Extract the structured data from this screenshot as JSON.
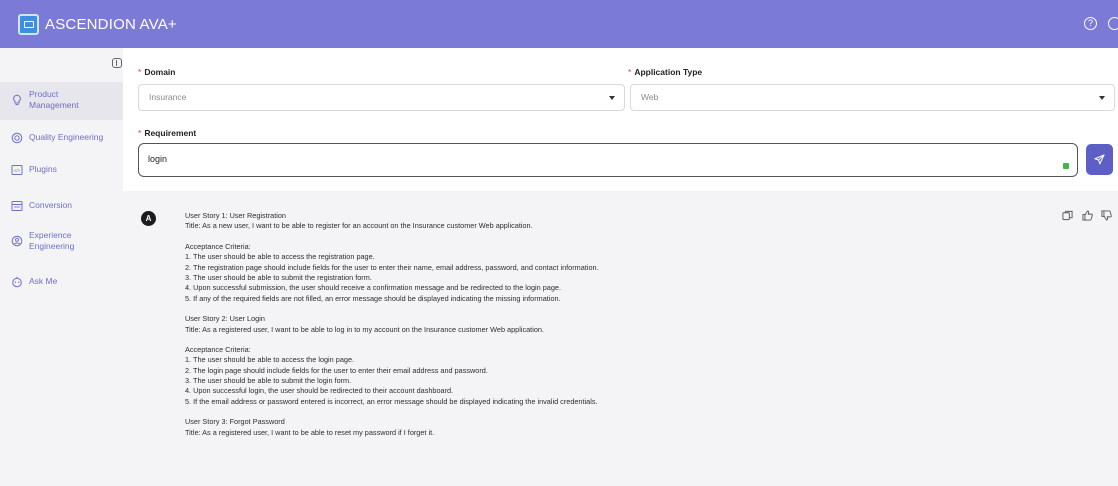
{
  "app": {
    "title": "ASCENDION AVA+"
  },
  "header": {
    "icons": [
      "help-icon",
      "settings-icon"
    ]
  },
  "sidebar": {
    "items": [
      {
        "label_line1": "Product",
        "label_line2": "Management",
        "icon": "bulb-icon",
        "active": true
      },
      {
        "label_line1": "Quality Engineering",
        "label_line2": "",
        "icon": "quality-icon",
        "active": false
      },
      {
        "label_line1": "Plugins",
        "label_line2": "",
        "icon": "plugin-icon",
        "active": false
      },
      {
        "label_line1": "Conversion",
        "label_line2": "",
        "icon": "conversion-icon",
        "active": false
      },
      {
        "label_line1": "Experience",
        "label_line2": "Engineering",
        "icon": "experience-icon",
        "active": false
      },
      {
        "label_line1": "Ask Me",
        "label_line2": "",
        "icon": "ask-me-icon",
        "active": false
      }
    ]
  },
  "form": {
    "required_mark": "*",
    "domain": {
      "label": "Domain",
      "value": "Insurance"
    },
    "application_type": {
      "label": "Application Type",
      "value": "Web"
    },
    "requirement": {
      "label": "Requirement",
      "value": "login"
    }
  },
  "response": {
    "avatar_letter": "A",
    "actions": [
      "copy-icon",
      "thumbs-up-icon",
      "thumbs-down-icon"
    ],
    "lines": [
      "User Story 1: User Registration",
      "Title: As a new user, I want to be able to register for an account on the Insurance customer Web application.",
      "",
      "Acceptance Criteria:",
      "1. The user should be able to access the registration page.",
      "2. The registration page should include fields for the user to enter their name, email address, password, and contact information.",
      "3. The user should be able to submit the registration form.",
      "4. Upon successful submission, the user should receive a confirmation message and be redirected to the login page.",
      "5. If any of the required fields are not filled, an error message should be displayed indicating the missing information.",
      "",
      "User Story 2: User Login",
      "Title: As a registered user, I want to be able to log in to my account on the Insurance customer Web application.",
      "",
      "Acceptance Criteria:",
      "1. The user should be able to access the login page.",
      "2. The login page should include fields for the user to enter their email address and password.",
      "3. The user should be able to submit the login form.",
      "4. Upon successful login, the user should be redirected to their account dashboard.",
      "5. If the email address or password entered is incorrect, an error message should be displayed indicating the invalid credentials.",
      "",
      "User Story 3: Forgot Password",
      "Title: As a registered user, I want to be able to reset my password if I forget it."
    ]
  }
}
